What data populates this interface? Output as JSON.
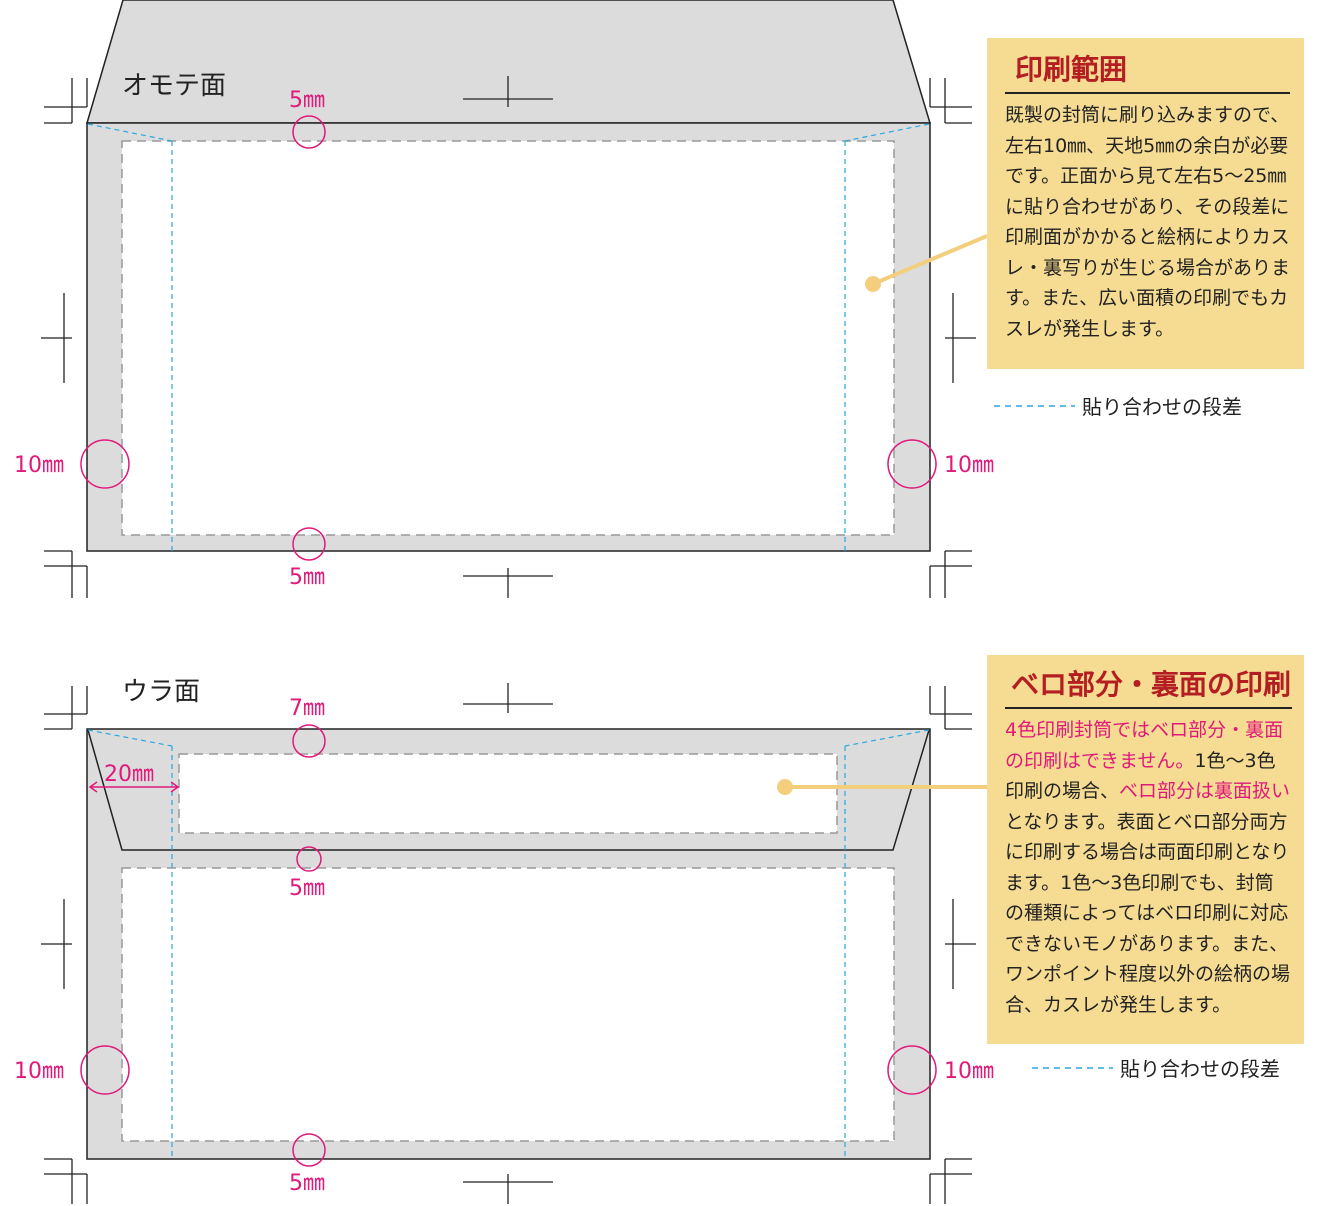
{
  "front": {
    "label": "オモテ面",
    "margin_top": "5㎜",
    "margin_bottom": "5㎜",
    "margin_left": "10㎜",
    "margin_right": "10㎜"
  },
  "back": {
    "label": "ウラ面",
    "flap_top": "7㎜",
    "flap_side": "20㎜",
    "margin_mid": "5㎜",
    "margin_bottom": "5㎜",
    "margin_left": "10㎜",
    "margin_right": "10㎜"
  },
  "note1": {
    "title": "印刷範囲",
    "body": "既製の封筒に刷り込みますので、左右10㎜、天地5㎜の余白が必要です。正面から見て左右5～25㎜に貼り合わせがあり、その段差に印刷面がかかると絵柄によりカスレ・裏写りが生じる場合があります。また、広い面積の印刷でもカスレが発生します。"
  },
  "note2": {
    "title": "ベロ部分・裏面の印刷",
    "body_pink1": "4色印刷封筒ではベロ部分・裏面の印刷はできません。",
    "body_text1": "1色～3色印刷の場合、",
    "body_pink2": "ベロ部分は裏面扱い",
    "body_text2": "となります。表面とベロ部分両方に印刷する場合は両面印刷となります。1色～3色印刷でも、封筒の種類によってはベロ印刷に対応できないモノがあります。また、ワンポイント程度以外の絵柄の場合、カスレが発生します。"
  },
  "legend": {
    "front": "貼り合わせの段差",
    "back": "貼り合わせの段差"
  },
  "colors": {
    "margin_pink": "#e0197a",
    "note_bg": "#f5dc92",
    "note_title": "#b41e23",
    "seam_blue": "#29a8e0",
    "gray_area": "#dcdcdc",
    "leader": "#f3cf7d"
  }
}
